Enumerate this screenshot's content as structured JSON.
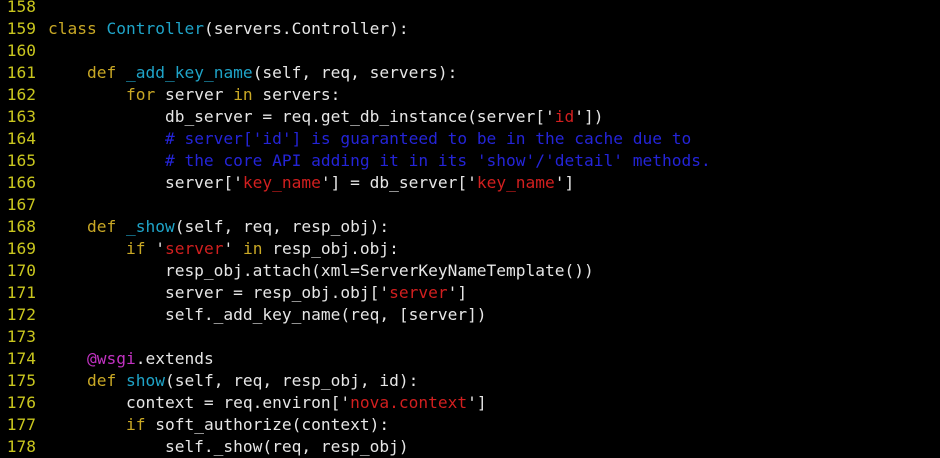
{
  "editor": {
    "lines": [
      {
        "number": "158",
        "tokens": []
      },
      {
        "number": "159",
        "tokens": [
          {
            "t": "class",
            "k": "keyword"
          },
          {
            "t": " ",
            "k": "plain"
          },
          {
            "t": "Controller",
            "k": "name"
          },
          {
            "t": "(servers.Controller):",
            "k": "plain"
          }
        ]
      },
      {
        "number": "160",
        "tokens": []
      },
      {
        "number": "161",
        "tokens": [
          {
            "t": "    ",
            "k": "plain"
          },
          {
            "t": "def",
            "k": "keyword"
          },
          {
            "t": " ",
            "k": "plain"
          },
          {
            "t": "_add_key_name",
            "k": "name"
          },
          {
            "t": "(self, req, servers):",
            "k": "plain"
          }
        ]
      },
      {
        "number": "162",
        "tokens": [
          {
            "t": "        ",
            "k": "plain"
          },
          {
            "t": "for",
            "k": "keyword"
          },
          {
            "t": " server ",
            "k": "plain"
          },
          {
            "t": "in",
            "k": "keyword"
          },
          {
            "t": " servers:",
            "k": "plain"
          }
        ]
      },
      {
        "number": "163",
        "tokens": [
          {
            "t": "            db_server = req.get_db_instance(server['",
            "k": "plain"
          },
          {
            "t": "id",
            "k": "string"
          },
          {
            "t": "'])",
            "k": "plain"
          }
        ]
      },
      {
        "number": "164",
        "tokens": [
          {
            "t": "            ",
            "k": "plain"
          },
          {
            "t": "# server['id'] is guaranteed to be in the cache due to",
            "k": "comment"
          }
        ]
      },
      {
        "number": "165",
        "tokens": [
          {
            "t": "            ",
            "k": "plain"
          },
          {
            "t": "# the core API adding it in its 'show'/'detail' methods.",
            "k": "comment"
          }
        ]
      },
      {
        "number": "166",
        "tokens": [
          {
            "t": "            server['",
            "k": "plain"
          },
          {
            "t": "key_name",
            "k": "string"
          },
          {
            "t": "'] = db_server['",
            "k": "plain"
          },
          {
            "t": "key_name",
            "k": "string"
          },
          {
            "t": "']",
            "k": "plain"
          }
        ]
      },
      {
        "number": "167",
        "tokens": []
      },
      {
        "number": "168",
        "tokens": [
          {
            "t": "    ",
            "k": "plain"
          },
          {
            "t": "def",
            "k": "keyword"
          },
          {
            "t": " ",
            "k": "plain"
          },
          {
            "t": "_show",
            "k": "name"
          },
          {
            "t": "(self, req, resp_obj):",
            "k": "plain"
          }
        ]
      },
      {
        "number": "169",
        "tokens": [
          {
            "t": "        ",
            "k": "plain"
          },
          {
            "t": "if",
            "k": "keyword"
          },
          {
            "t": " '",
            "k": "plain"
          },
          {
            "t": "server",
            "k": "string"
          },
          {
            "t": "' ",
            "k": "plain"
          },
          {
            "t": "in",
            "k": "keyword"
          },
          {
            "t": " resp_obj.obj:",
            "k": "plain"
          }
        ]
      },
      {
        "number": "170",
        "tokens": [
          {
            "t": "            resp_obj.attach(xml=ServerKeyNameTemplate())",
            "k": "plain"
          }
        ]
      },
      {
        "number": "171",
        "tokens": [
          {
            "t": "            server = resp_obj.obj['",
            "k": "plain"
          },
          {
            "t": "server",
            "k": "string"
          },
          {
            "t": "']",
            "k": "plain"
          }
        ]
      },
      {
        "number": "172",
        "tokens": [
          {
            "t": "            self._add_key_name(req, [server])",
            "k": "plain"
          }
        ]
      },
      {
        "number": "173",
        "tokens": []
      },
      {
        "number": "174",
        "tokens": [
          {
            "t": "    ",
            "k": "plain"
          },
          {
            "t": "@wsgi",
            "k": "decorator"
          },
          {
            "t": ".extends",
            "k": "plain"
          }
        ]
      },
      {
        "number": "175",
        "tokens": [
          {
            "t": "    ",
            "k": "plain"
          },
          {
            "t": "def",
            "k": "keyword"
          },
          {
            "t": " ",
            "k": "plain"
          },
          {
            "t": "show",
            "k": "name"
          },
          {
            "t": "(self, req, resp_obj, id):",
            "k": "plain"
          }
        ]
      },
      {
        "number": "176",
        "tokens": [
          {
            "t": "        context = req.environ['",
            "k": "plain"
          },
          {
            "t": "nova.context",
            "k": "string"
          },
          {
            "t": "']",
            "k": "plain"
          }
        ]
      },
      {
        "number": "177",
        "tokens": [
          {
            "t": "        ",
            "k": "plain"
          },
          {
            "t": "if",
            "k": "keyword"
          },
          {
            "t": " soft_authorize(context):",
            "k": "plain"
          }
        ]
      },
      {
        "number": "178",
        "tokens": [
          {
            "t": "            self._show(req, resp_obj)",
            "k": "plain"
          }
        ]
      }
    ]
  },
  "colors": {
    "background": "#000000",
    "line_number": "#c9c61e",
    "plain": "#e6e6e6",
    "keyword": "#c9a825",
    "name": "#1fa4c8",
    "string": "#d21f1f",
    "comment": "#2424d8",
    "decorator": "#c232c2"
  }
}
